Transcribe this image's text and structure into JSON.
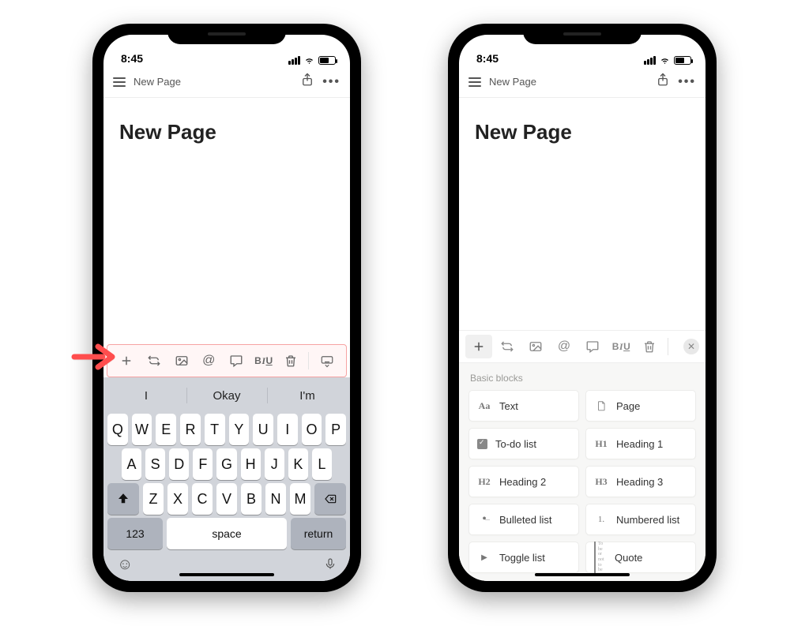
{
  "status": {
    "time": "8:45"
  },
  "header": {
    "breadcrumb": "New Page"
  },
  "page": {
    "title": "New Page"
  },
  "toolbar": {
    "format_label_b": "B",
    "format_label_i": "I",
    "format_label_u": "U"
  },
  "keyboard": {
    "suggestions": [
      "I",
      "Okay",
      "I'm"
    ],
    "row1": [
      "Q",
      "W",
      "E",
      "R",
      "T",
      "Y",
      "U",
      "I",
      "O",
      "P"
    ],
    "row2": [
      "A",
      "S",
      "D",
      "F",
      "G",
      "H",
      "J",
      "K",
      "L"
    ],
    "row3": [
      "Z",
      "X",
      "C",
      "V",
      "B",
      "N",
      "M"
    ],
    "numbers_label": "123",
    "space_label": "space",
    "return_label": "return"
  },
  "blocks": {
    "section_title": "Basic blocks",
    "items": [
      {
        "label": "Text",
        "icon": "Aa",
        "kind": "serif"
      },
      {
        "label": "Page",
        "icon": "",
        "kind": "page"
      },
      {
        "label": "To-do list",
        "icon": "",
        "kind": "checkbox"
      },
      {
        "label": "Heading 1",
        "icon": "H1",
        "kind": "serif"
      },
      {
        "label": "Heading 2",
        "icon": "H2",
        "kind": "serif"
      },
      {
        "label": "Heading 3",
        "icon": "H3",
        "kind": "serif"
      },
      {
        "label": "Bulleted list",
        "icon": "",
        "kind": "bullet"
      },
      {
        "label": "Numbered list",
        "icon": "1.",
        "kind": "num"
      },
      {
        "label": "Toggle list",
        "icon": "",
        "kind": "toggle"
      },
      {
        "label": "Quote",
        "icon": "To be or not to be",
        "kind": "quote"
      }
    ]
  }
}
